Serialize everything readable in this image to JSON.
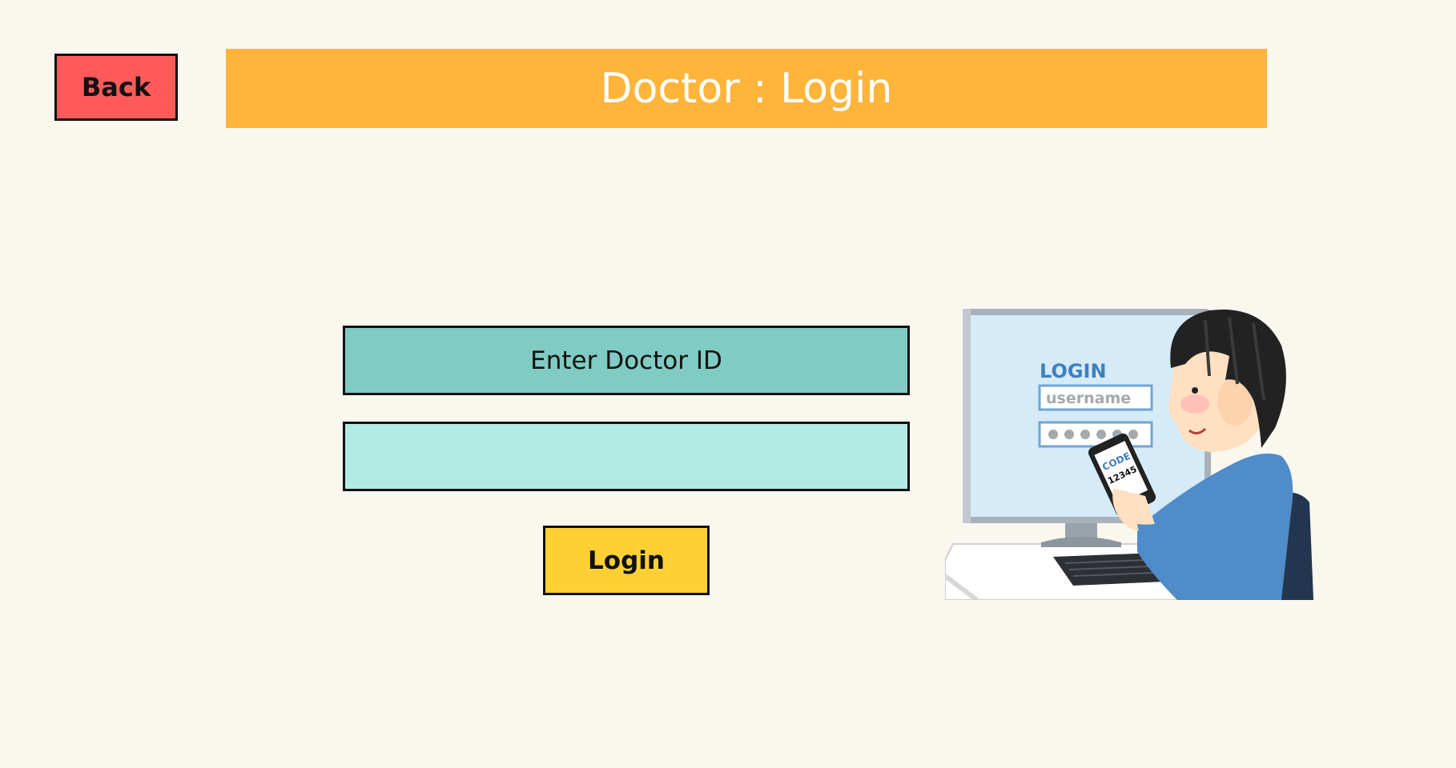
{
  "header": {
    "back_label": "Back",
    "title": "Doctor : Login"
  },
  "form": {
    "id_label": "Enter Doctor ID",
    "id_value": "",
    "id_placeholder": "",
    "login_label": "Login"
  },
  "illustration": {
    "screen_heading": "LOGIN",
    "username_field": "username",
    "phone_code_label": "CODE",
    "phone_code_value": "12345",
    "icon": "person-login-with-2fa-illustration"
  },
  "colors": {
    "background": "#faf7ef",
    "back_button": "#ff5a5a",
    "title_banner": "#ffb43a",
    "id_label_bg": "#80cbc4",
    "id_input_bg": "#b2ebe4",
    "login_button": "#ffd034"
  }
}
